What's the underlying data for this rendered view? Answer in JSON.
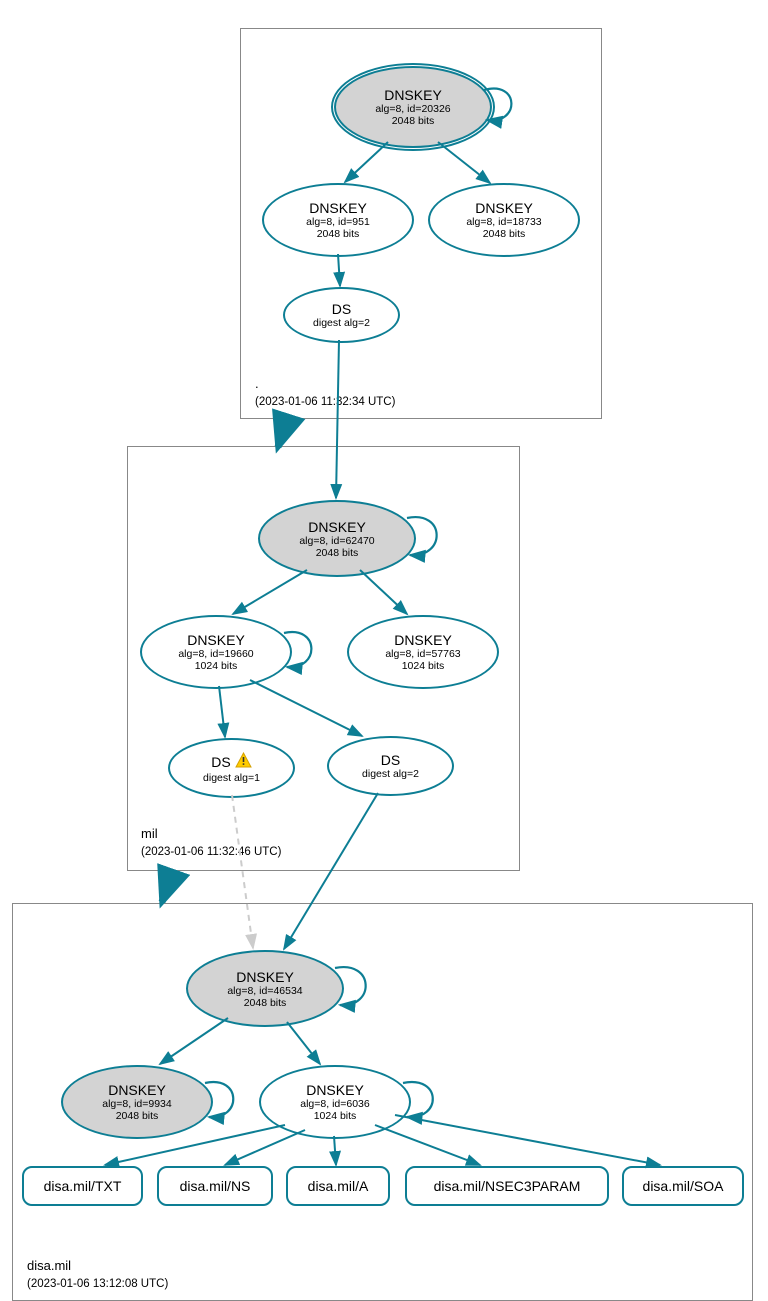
{
  "zones": {
    "root": {
      "label": ".",
      "ts": "(2023-01-06 11:32:34 UTC)"
    },
    "mil": {
      "label": "mil",
      "ts": "(2023-01-06 11:32:46 UTC)"
    },
    "disa": {
      "label": "disa.mil",
      "ts": "(2023-01-06 13:12:08 UTC)"
    }
  },
  "nodes": {
    "root_ksk": {
      "title": "DNSKEY",
      "sub1": "alg=8, id=20326",
      "sub2": "2048 bits"
    },
    "root_zsk1": {
      "title": "DNSKEY",
      "sub1": "alg=8, id=951",
      "sub2": "2048 bits"
    },
    "root_zsk2": {
      "title": "DNSKEY",
      "sub1": "alg=8, id=18733",
      "sub2": "2048 bits"
    },
    "root_ds": {
      "title": "DS",
      "sub1": "digest alg=2"
    },
    "mil_ksk": {
      "title": "DNSKEY",
      "sub1": "alg=8, id=62470",
      "sub2": "2048 bits"
    },
    "mil_zsk1": {
      "title": "DNSKEY",
      "sub1": "alg=8, id=19660",
      "sub2": "1024 bits"
    },
    "mil_zsk2": {
      "title": "DNSKEY",
      "sub1": "alg=8, id=57763",
      "sub2": "1024 bits"
    },
    "mil_ds1": {
      "title": "DS",
      "sub1": "digest alg=1"
    },
    "mil_ds2": {
      "title": "DS",
      "sub1": "digest alg=2"
    },
    "disa_ksk": {
      "title": "DNSKEY",
      "sub1": "alg=8, id=46534",
      "sub2": "2048 bits"
    },
    "disa_zsk1": {
      "title": "DNSKEY",
      "sub1": "alg=8, id=9934",
      "sub2": "2048 bits"
    },
    "disa_zsk2": {
      "title": "DNSKEY",
      "sub1": "alg=8, id=6036",
      "sub2": "1024 bits"
    },
    "rr_txt": "disa.mil/TXT",
    "rr_ns": "disa.mil/NS",
    "rr_a": "disa.mil/A",
    "rr_nsec3": "disa.mil/NSEC3PARAM",
    "rr_soa": "disa.mil/SOA"
  }
}
